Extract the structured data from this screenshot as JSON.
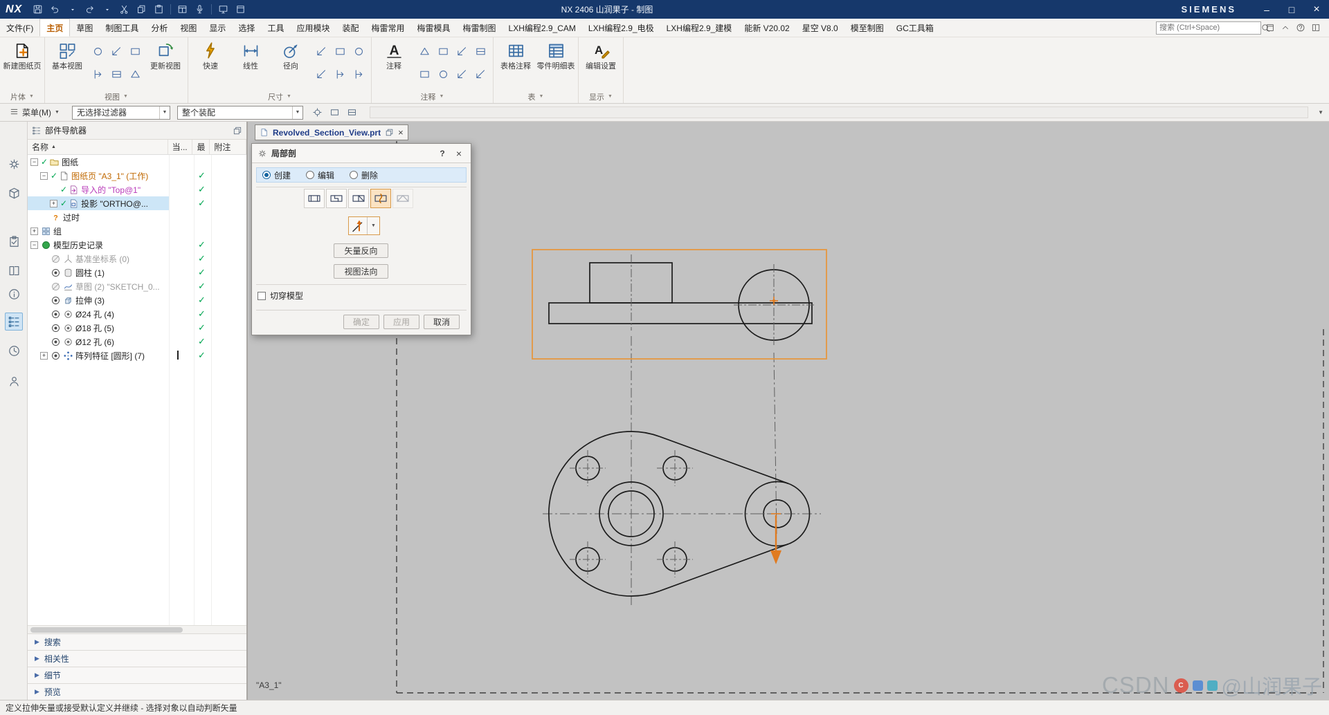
{
  "colors": {
    "titlebar_blue": "#16386b",
    "selection_orange": "#e5973f",
    "check_green": "#00a651"
  },
  "titlebar": {
    "logo": "NX",
    "title": "NX 2406 山润果子 - 制图",
    "brand": "SIEMENS",
    "quick_icons": [
      "save-icon",
      "undo-icon",
      "undo-caret-icon",
      "redo-icon",
      "redo-caret-icon",
      "cut-icon",
      "copy-icon",
      "paste-icon",
      "sep",
      "window-menu-icon",
      "microphone-icon",
      "sep",
      "monitor-icon",
      "window-icon"
    ],
    "window_icons": [
      {
        "name": "minimize-icon",
        "glyph": "–"
      },
      {
        "name": "maximize-icon",
        "glyph": "□"
      },
      {
        "name": "close-icon",
        "glyph": "×"
      }
    ]
  },
  "menubar": {
    "tabs": [
      {
        "label": "文件(F)"
      },
      {
        "label": "主页",
        "active": true
      },
      {
        "label": "草图"
      },
      {
        "label": "制图工具"
      },
      {
        "label": "分析"
      },
      {
        "label": "视图"
      },
      {
        "label": "显示"
      },
      {
        "label": "选择"
      },
      {
        "label": "工具"
      },
      {
        "label": "应用模块"
      },
      {
        "label": "装配"
      },
      {
        "label": "梅雷常用"
      },
      {
        "label": "梅雷模具"
      },
      {
        "label": "梅雷制图"
      },
      {
        "label": "LXH编程2.9_CAM"
      },
      {
        "label": "LXH编程2.9_电极"
      },
      {
        "label": "LXH编程2.9_建模"
      },
      {
        "label": "能新 V20.02"
      },
      {
        "label": "星空 V8.0"
      },
      {
        "label": "模至制图"
      },
      {
        "label": "GC工具箱"
      }
    ],
    "search_placeholder": "搜索 (Ctrl+Space)",
    "right_icons": [
      "layout-icon",
      "collapse-ribbon-icon",
      "help-icon",
      "favorites-icon"
    ]
  },
  "ribbon": {
    "groups": [
      {
        "label": "片体",
        "big": [
          {
            "label": "新建图纸页",
            "icon": "new-sheet-icon"
          }
        ],
        "small": []
      },
      {
        "label": "视图",
        "big": [
          {
            "label": "基本视图",
            "icon": "base-view-icon"
          },
          {
            "label": "更新视图",
            "icon": "update-view-icon"
          }
        ],
        "small": [
          "projected-view-icon",
          "section-view-icon",
          "detail-view-icon",
          "break-view-icon",
          "view-boundary-icon",
          "display-options-icon"
        ],
        "small_between": true
      },
      {
        "label": "尺寸",
        "big": [
          {
            "label": "快速",
            "icon": "quick-dim-icon"
          },
          {
            "label": "线性",
            "icon": "linear-dim-icon"
          },
          {
            "label": "径向",
            "icon": "radial-dim-icon"
          }
        ],
        "small": [
          "angular-dim-icon",
          "chamfer-dim-icon",
          "thickness-dim-icon",
          "ordinate-dim-icon",
          "hole-dim-icon",
          "baseline-dim-icon"
        ]
      },
      {
        "label": "注释",
        "big": [
          {
            "label": "注释",
            "icon": "note-icon"
          }
        ],
        "small": [
          "feature-control-frame-icon",
          "datum-feature-icon",
          "balloon-icon",
          "surface-finish-icon",
          "weld-symbol-icon",
          "center-mark-icon",
          "crosshatch-icon",
          "image-icon"
        ]
      },
      {
        "label": "表",
        "big": [
          {
            "label": "表格注释",
            "icon": "tabular-note-icon"
          },
          {
            "label": "零件明细表",
            "icon": "parts-list-icon"
          }
        ],
        "small": []
      },
      {
        "label": "显示",
        "big": [
          {
            "label": "编辑设置",
            "icon": "edit-settings-icon"
          }
        ],
        "small": []
      }
    ]
  },
  "toolbar2": {
    "menu_label": "菜单(M)",
    "filter_value": "无选择过滤器",
    "scope_value": "整个装配",
    "icons": [
      "snap-point-icon",
      "work-layer-icon",
      "pair-icon"
    ]
  },
  "rail": {
    "icons": [
      {
        "name": "settings-gear-icon"
      },
      {
        "name": "assembly-navigator-icon"
      },
      {
        "name": "constraint-navigator-icon"
      },
      {
        "name": "reuse-library-icon"
      },
      {
        "name": "hd3d-tools-icon"
      },
      {
        "name": "part-navigator-icon",
        "selected": true
      },
      {
        "name": "history-icon"
      },
      {
        "name": "roles-icon"
      }
    ]
  },
  "navigator": {
    "title": "部件导航器",
    "columns": [
      "名称",
      "当...",
      "最",
      "附注"
    ],
    "rows": [
      {
        "depth": 0,
        "expander": "minus",
        "pre_check": true,
        "icon": "folder",
        "label": "图纸"
      },
      {
        "depth": 1,
        "expander": "minus",
        "pre_check": true,
        "icon": "sheet",
        "label": "图纸页 \"A3_1\" (工作)",
        "color": "orange",
        "check": true
      },
      {
        "depth": 2,
        "pre_check": true,
        "icon": "import-view",
        "label": "导入的 \"Top@1\"",
        "color": "magenta",
        "check": true
      },
      {
        "depth": 2,
        "expander": "plus",
        "pre_check": true,
        "icon": "projected-view",
        "label": "投影 \"ORTHO@...",
        "check": true,
        "selected": true
      },
      {
        "depth": 1,
        "icon": "question",
        "label": "过时"
      },
      {
        "depth": 0,
        "expander": "plus",
        "icon": "group",
        "label": "组"
      },
      {
        "depth": 0,
        "expander": "minus",
        "icon": "history-node",
        "label": "模型历史记录",
        "check": true
      },
      {
        "depth": 1,
        "eye": "off",
        "icon": "csys",
        "label": "基准坐标系 (0)",
        "color": "gray",
        "check": true
      },
      {
        "depth": 1,
        "eye": "on",
        "icon": "cylinder",
        "label": "圆柱 (1)",
        "check": true
      },
      {
        "depth": 1,
        "eye": "off",
        "icon": "sketch",
        "label": "草图 (2) \"SKETCH_0...",
        "color": "gray",
        "check": true
      },
      {
        "depth": 1,
        "eye": "on",
        "icon": "extrude",
        "label": "拉伸 (3)",
        "check": true
      },
      {
        "depth": 1,
        "eye": "on",
        "icon": "hole",
        "label": "Ø24 孔 (4)",
        "check": true
      },
      {
        "depth": 1,
        "eye": "on",
        "icon": "hole",
        "label": "Ø18 孔 (5)",
        "check": true
      },
      {
        "depth": 1,
        "eye": "on",
        "icon": "hole",
        "label": "Ø12 孔 (6)",
        "check": true
      },
      {
        "depth": 1,
        "expander": "plus",
        "eye": "on",
        "icon": "pattern",
        "label": "阵列特征 [圆形] (7)",
        "check": true,
        "cursor": true
      }
    ],
    "sections": [
      "搜索",
      "相关性",
      "细节",
      "预览"
    ]
  },
  "canvas": {
    "tab": "Revolved_Section_View.prt",
    "sheet_label": "\"A3_1\""
  },
  "dialog": {
    "title": "局部剖",
    "help_glyph": "?",
    "close_glyph": "×",
    "radios": [
      {
        "label": "创建",
        "checked": true
      },
      {
        "label": "编辑",
        "checked": false
      },
      {
        "label": "删除",
        "checked": false
      }
    ],
    "section_types": [
      {
        "name": "section-line-icon"
      },
      {
        "name": "stepped-section-icon"
      },
      {
        "name": "half-section-icon"
      },
      {
        "name": "breakout-section-icon",
        "active": true
      },
      {
        "name": "unfolded-section-icon",
        "disabled": true
      }
    ],
    "reverse_button": "矢量反向",
    "normal_button": "视图法向",
    "cut_checkbox": "切穿模型",
    "ok": "确定",
    "apply": "应用",
    "cancel": "取消"
  },
  "statusbar": {
    "message": "定义拉伸矢量或接受默认定义并继续 - 选择对象以自动判断矢量"
  },
  "watermark": {
    "prefix": "CSDN",
    "badge": "C",
    "suffix": "@山润果子"
  }
}
